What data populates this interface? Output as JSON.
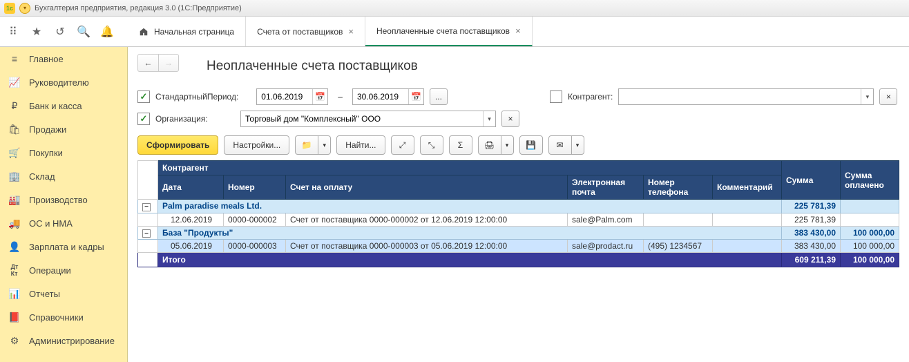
{
  "app_title": "Бухгалтерия предприятия, редакция 3.0  (1С:Предприятие)",
  "tabs": {
    "home": "Начальная страница",
    "t1": "Счета от поставщиков",
    "t2": "Неоплаченные счета поставщиков"
  },
  "sidebar": [
    {
      "icon": "menu",
      "label": "Главное"
    },
    {
      "icon": "chart",
      "label": "Руководителю"
    },
    {
      "icon": "ruble",
      "label": "Банк и касса"
    },
    {
      "icon": "bag",
      "label": "Продажи"
    },
    {
      "icon": "cart",
      "label": "Покупки"
    },
    {
      "icon": "warehouse",
      "label": "Склад"
    },
    {
      "icon": "factory",
      "label": "Производство"
    },
    {
      "icon": "truck",
      "label": "ОС и НМА"
    },
    {
      "icon": "person",
      "label": "Зарплата и кадры"
    },
    {
      "icon": "dtkt",
      "label": "Операции"
    },
    {
      "icon": "bars",
      "label": "Отчеты"
    },
    {
      "icon": "book",
      "label": "Справочники"
    },
    {
      "icon": "gear",
      "label": "Администрирование"
    }
  ],
  "page_title": "Неоплаченные счета поставщиков",
  "filters": {
    "period_label": "СтандартныйПериод:",
    "date_from": "01.06.2019",
    "date_to": "30.06.2019",
    "more": "...",
    "counterparty_label": "Контрагент:",
    "counterparty_value": "",
    "org_label": "Организация:",
    "org_value": "Торговый дом \"Комплексный\" ООО"
  },
  "toolbar": {
    "generate": "Сформировать",
    "settings": "Настройки...",
    "find": "Найти..."
  },
  "table": {
    "headers": {
      "counterparty": "Контрагент",
      "date": "Дата",
      "number": "Номер",
      "invoice": "Счет на оплату",
      "email": "Электронная почта",
      "phone": "Номер телефона",
      "comment": "Комментарий",
      "sum": "Сумма",
      "paid": "Сумма оплачено"
    },
    "group1": {
      "name": "Palm paradise meals Ltd.",
      "sum": "225 781,39",
      "paid": "",
      "rows": [
        {
          "date": "12.06.2019",
          "number": "0000-000002",
          "invoice": "Счет от поставщика 0000-000002 от 12.06.2019 12:00:00",
          "email": "sale@Palm.com",
          "phone": "",
          "comment": "",
          "sum": "225 781,39",
          "paid": ""
        }
      ]
    },
    "group2": {
      "name": "База \"Продукты\"",
      "sum": "383 430,00",
      "paid": "100 000,00",
      "rows": [
        {
          "date": "05.06.2019",
          "number": "0000-000003",
          "invoice": "Счет от поставщика 0000-000003 от 05.06.2019 12:00:00",
          "email": "sale@prodact.ru",
          "phone": "(495) 1234567",
          "comment": "",
          "sum": "383 430,00",
          "paid": "100 000,00"
        }
      ]
    },
    "total": {
      "label": "Итого",
      "sum": "609 211,39",
      "paid": "100 000,00"
    }
  }
}
